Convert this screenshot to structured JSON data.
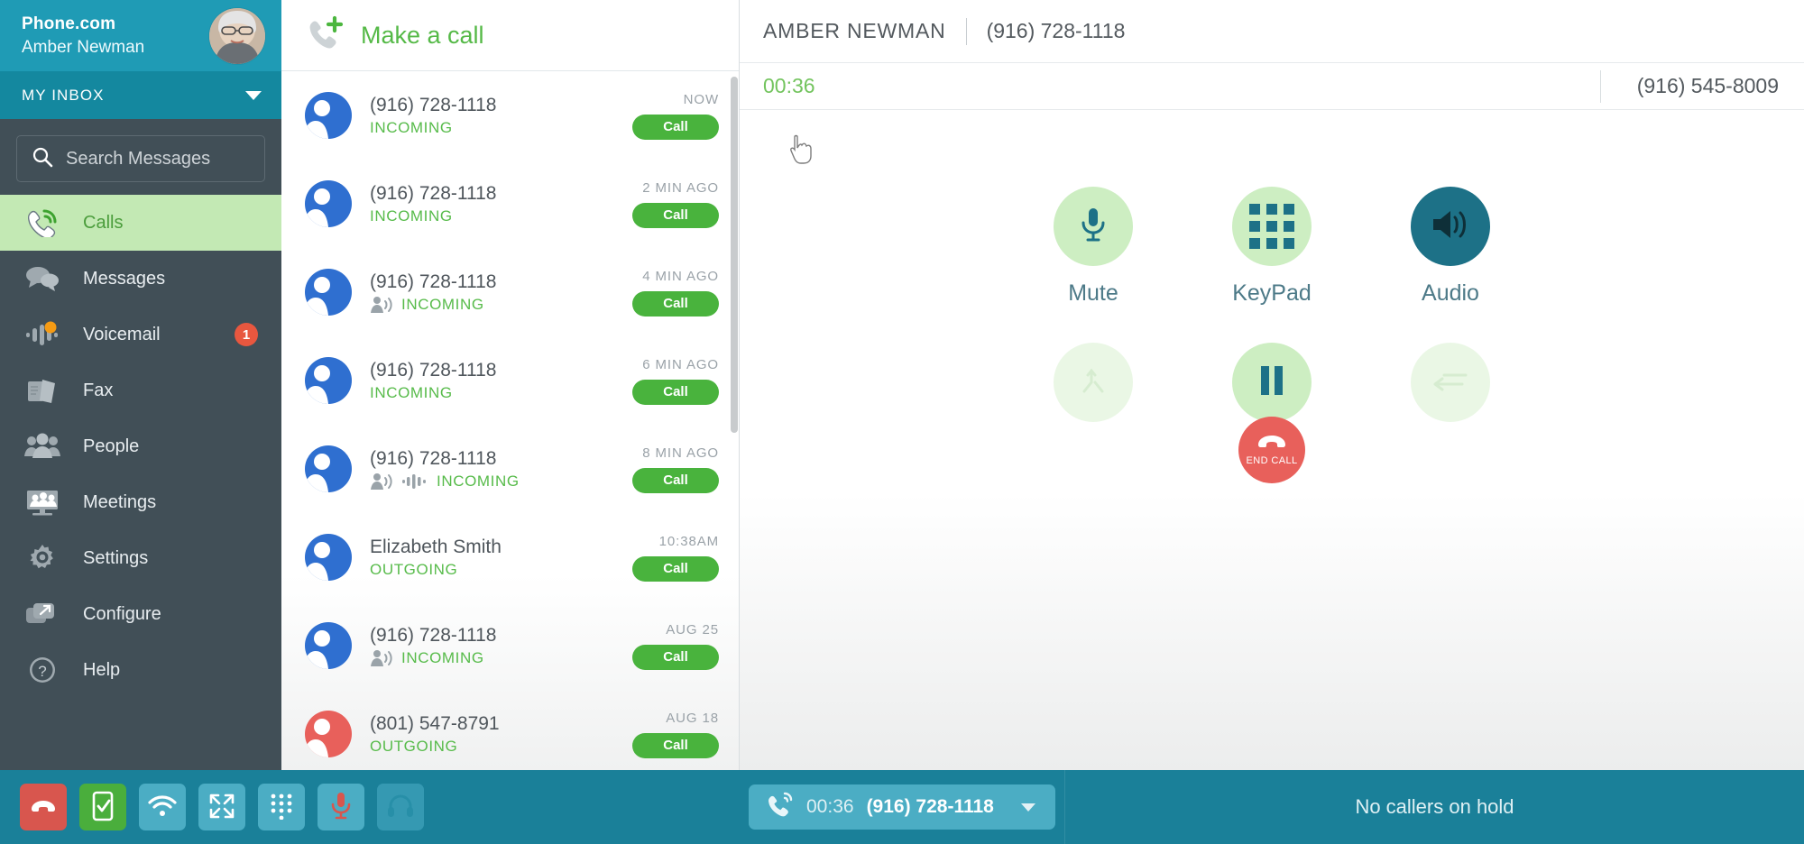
{
  "sidebar": {
    "brand": "Phone.com",
    "user_name": "Amber Newman",
    "avatar_icon": "user-avatar-photo",
    "inbox_label": "MY INBOX",
    "inbox_caret_icon": "chevron-down-icon",
    "search": {
      "placeholder": "Search Messages",
      "value": "",
      "icon": "search-icon"
    },
    "items": [
      {
        "label": "Calls",
        "icon": "phone-incoming-icon",
        "active": true,
        "badge": ""
      },
      {
        "label": "Messages",
        "icon": "chat-bubbles-icon",
        "active": false,
        "badge": ""
      },
      {
        "label": "Voicemail",
        "icon": "voicemail-wave-icon",
        "active": false,
        "badge": "1"
      },
      {
        "label": "Fax",
        "icon": "fax-pages-icon",
        "active": false,
        "badge": ""
      },
      {
        "label": "People",
        "icon": "people-group-icon",
        "active": false,
        "badge": ""
      },
      {
        "label": "Meetings",
        "icon": "meeting-screen-icon",
        "active": false,
        "badge": ""
      },
      {
        "label": "Settings",
        "icon": "gear-icon",
        "active": false,
        "badge": ""
      },
      {
        "label": "Configure",
        "icon": "external-window-icon",
        "active": false,
        "badge": ""
      },
      {
        "label": "Help",
        "icon": "question-circle-icon",
        "active": false,
        "badge": ""
      }
    ]
  },
  "call_list": {
    "header_label": "Make a call",
    "header_icon": "phone-plus-icon",
    "call_button_label": "Call",
    "rows": [
      {
        "name": "(916) 728-1118",
        "direction": "INCOMING",
        "time": "NOW",
        "avatar_color": "blue",
        "icons": []
      },
      {
        "name": "(916) 728-1118",
        "direction": "INCOMING",
        "time": "2 MIN AGO",
        "avatar_color": "blue",
        "icons": []
      },
      {
        "name": "(916) 728-1118",
        "direction": "INCOMING",
        "time": "4 MIN AGO",
        "avatar_color": "blue",
        "icons": [
          "person-speaking-icon"
        ]
      },
      {
        "name": "(916) 728-1118",
        "direction": "INCOMING",
        "time": "6 MIN AGO",
        "avatar_color": "blue",
        "icons": []
      },
      {
        "name": "(916) 728-1118",
        "direction": "INCOMING",
        "time": "8 MIN AGO",
        "avatar_color": "blue",
        "icons": [
          "person-speaking-icon",
          "voicemail-wave-icon"
        ]
      },
      {
        "name": "Elizabeth Smith",
        "direction": "OUTGOING",
        "time": "10:38AM",
        "avatar_color": "blue",
        "icons": []
      },
      {
        "name": "(916) 728-1118",
        "direction": "INCOMING",
        "time": "AUG 25",
        "avatar_color": "blue",
        "icons": [
          "person-speaking-icon"
        ]
      },
      {
        "name": "(801) 547-8791",
        "direction": "OUTGOING",
        "time": "AUG 18",
        "avatar_color": "red",
        "icons": []
      }
    ]
  },
  "call_panel": {
    "title": "AMBER NEWMAN",
    "number": "(916) 728-1118",
    "timer": "00:36",
    "alt_number": "(916) 545-8009",
    "controls_row1": [
      {
        "label": "Mute",
        "icon": "microphone-icon",
        "state": "enabled"
      },
      {
        "label": "KeyPad",
        "icon": "keypad-grid-icon",
        "state": "enabled"
      },
      {
        "label": "Audio",
        "icon": "speaker-icon",
        "state": "selected"
      }
    ],
    "controls_row2": [
      {
        "label": "",
        "icon": "merge-call-icon",
        "state": "disabled"
      },
      {
        "label": "Hold",
        "icon": "pause-icon",
        "state": "enabled"
      },
      {
        "label": "",
        "icon": "transfer-call-icon",
        "state": "disabled"
      }
    ],
    "end_call": {
      "label": "END CALL",
      "icon": "phone-hangup-icon"
    }
  },
  "bottom_bar": {
    "buttons": [
      {
        "icon": "phone-hangup-icon",
        "style": "red"
      },
      {
        "icon": "phone-check-icon",
        "style": "green"
      },
      {
        "icon": "wifi-icon",
        "style": "normal"
      },
      {
        "icon": "expand-icon",
        "style": "normal"
      },
      {
        "icon": "dialpad-icon",
        "style": "normal"
      },
      {
        "icon": "microphone-red-icon",
        "style": "normal"
      },
      {
        "icon": "headset-icon",
        "style": "dim"
      }
    ],
    "active_call": {
      "icon": "phone-ringing-icon",
      "duration": "00:36",
      "number": "(916) 728-1118",
      "caret_icon": "chevron-down-icon"
    },
    "hold_status": "No callers on hold"
  },
  "colors": {
    "teal": "#1a8099",
    "teal_light": "#1f9bb5",
    "sidebar": "#414f57",
    "green": "#49b33d",
    "green_light": "#cdeec2",
    "red": "#e8605b",
    "dark_teal": "#1d7187",
    "badge": "#e8573f"
  }
}
